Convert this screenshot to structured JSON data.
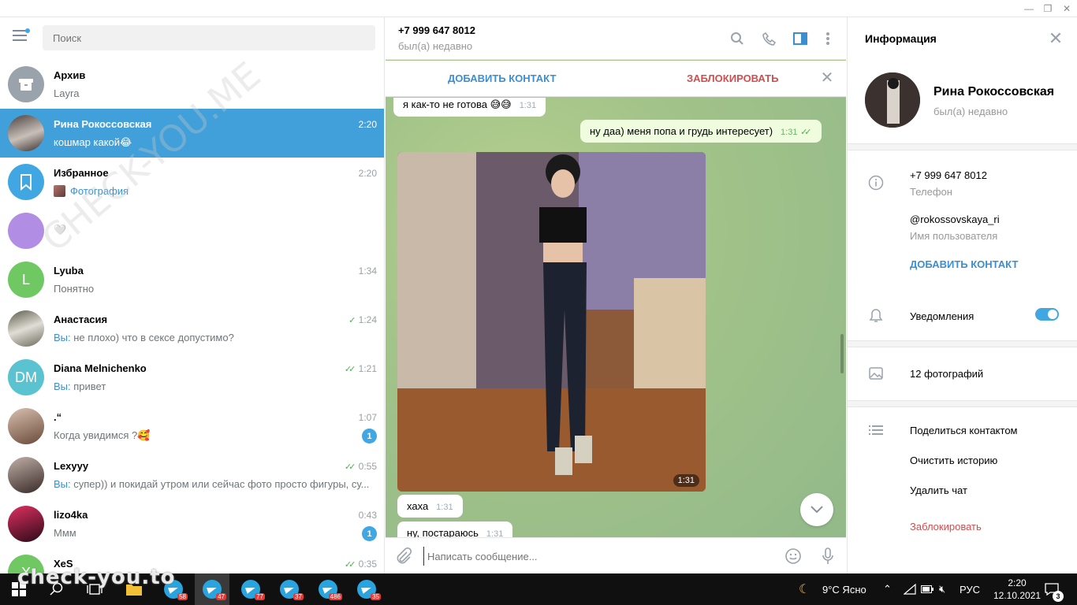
{
  "left": {
    "search_placeholder": "Поиск",
    "chats": [
      {
        "name": "Архив",
        "preview": "Layra",
        "time": "",
        "avatar": "archive"
      },
      {
        "name": "Рина Рокоссовская",
        "preview": "кошмар какой😂",
        "time": "2:20",
        "active": true
      },
      {
        "name": "Избранное",
        "preview": "Фотография",
        "time": "2:20"
      },
      {
        "name": "",
        "preview": "🤍",
        "time": ""
      },
      {
        "name": "Lyuba",
        "preview": "Понятно",
        "time": "1:34",
        "initial": "L"
      },
      {
        "name": "Анастасия",
        "you": "Вы:",
        "preview": " не плохо) что в сексе допустимо?",
        "time": "1:24"
      },
      {
        "name": "Diana Melnichenko",
        "you": "Вы:",
        "preview": " привет",
        "time": "1:21",
        "initial": "DM"
      },
      {
        "name": ".“",
        "preview": "Когда увидимся ?🥰",
        "time": "1:07",
        "unread": "1"
      },
      {
        "name": "Lexyyy",
        "you": "Вы:",
        "preview": " супер)) и покидай утром или сейчас фото просто фигуры, су...",
        "time": "0:55"
      },
      {
        "name": "lizo4ka",
        "preview": "Ммм",
        "time": "0:43",
        "unread": "1"
      },
      {
        "name": "XeS",
        "preview": "",
        "time": "0:35",
        "initial": "X"
      }
    ]
  },
  "chat": {
    "title": "+7 999 647 8012",
    "status": "был(а) недавно",
    "add_contact": "ДОБАВИТЬ КОНТАКТ",
    "block": "ЗАБЛОКИРОВАТЬ",
    "messages": {
      "m1_text": "я как-то не готова 😅😅",
      "m1_time": "1:31",
      "m2_text": "ну даа) меня попа и грудь интересует)",
      "m2_time": "1:31",
      "photo_time": "1:31",
      "m3_text": "хаха",
      "m3_time": "1:31",
      "m4_text": "ну, постараюсь",
      "m4_time": "1:31"
    },
    "composer_placeholder": "Написать сообщение..."
  },
  "info": {
    "title": "Информация",
    "name": "Рина Рокоссовская",
    "status": "был(а) недавно",
    "phone": "+7 999 647 8012",
    "phone_label": "Телефон",
    "username": "@rokossovskaya_ri",
    "username_label": "Имя пользователя",
    "add_contact": "ДОБАВИТЬ КОНТАКТ",
    "notifications": "Уведомления",
    "notifications_on": true,
    "photos": "12 фотографий",
    "share": "Поделиться контактом",
    "clear": "Очистить историю",
    "delete": "Удалить чат",
    "block": "Заблокировать"
  },
  "taskbar": {
    "badges": [
      "58",
      "47",
      "77",
      "37",
      "486",
      "35"
    ],
    "weather": "9°C  Ясно",
    "lang": "РУС",
    "time": "2:20",
    "date": "12.10.2021",
    "notif_count": "3",
    "watermark": "check-you.to"
  },
  "watermark_diag": "CHECK-YOU.ME",
  "colors": {
    "accent": "#419fd9",
    "link": "#3a8fd3",
    "danger": "#d14e4e",
    "out_bubble": "#effdde"
  }
}
